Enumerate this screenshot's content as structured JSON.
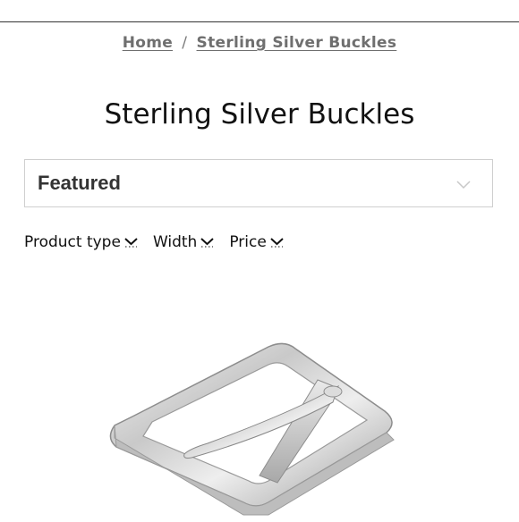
{
  "breadcrumb": {
    "home": "Home",
    "separator": "/",
    "current": "Sterling Silver Buckles"
  },
  "page_title": "Sterling Silver Buckles",
  "sort": {
    "selected": "Featured",
    "icon": "chevron-down-icon"
  },
  "filters": [
    {
      "label": "Product type",
      "icon": "chevron-down-icon"
    },
    {
      "label": "Width",
      "icon": "chevron-down-icon"
    },
    {
      "label": "Price",
      "icon": "chevron-down-icon"
    }
  ],
  "product": {
    "image": "silver-belt-buckle"
  }
}
